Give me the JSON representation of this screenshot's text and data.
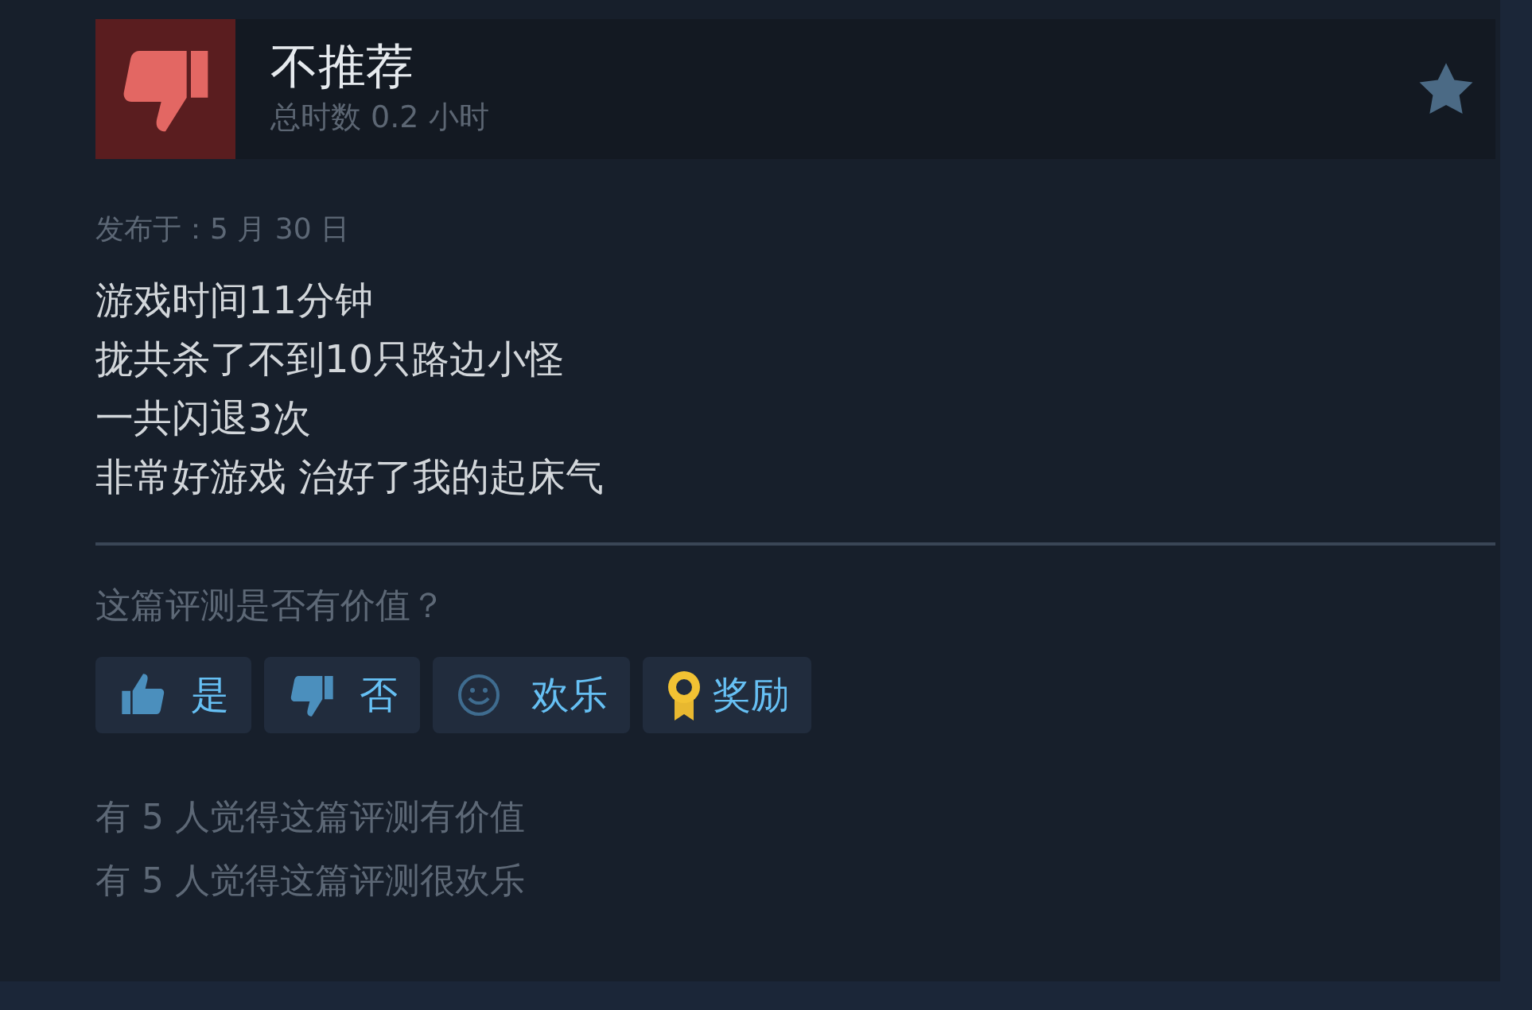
{
  "review": {
    "verdict": "不推荐",
    "recommended": false,
    "hours": "总时数 0.2 小时",
    "posted": "发布于：5 月 30 日",
    "body": [
      "游戏时间11分钟",
      "拢共杀了不到10只路边小怪",
      "一共闪退3次",
      "非常好游戏 治好了我的起床气"
    ],
    "question": "这篇评测是否有价值？",
    "buttons": [
      {
        "kind": "up",
        "label": "是"
      },
      {
        "kind": "down",
        "label": "否"
      },
      {
        "kind": "funny",
        "label": "欢乐"
      },
      {
        "kind": "award",
        "label": "奖励"
      }
    ],
    "stats": [
      "有 5 人觉得这篇评测有价值",
      "有 5 人觉得这篇评测很欢乐"
    ]
  }
}
